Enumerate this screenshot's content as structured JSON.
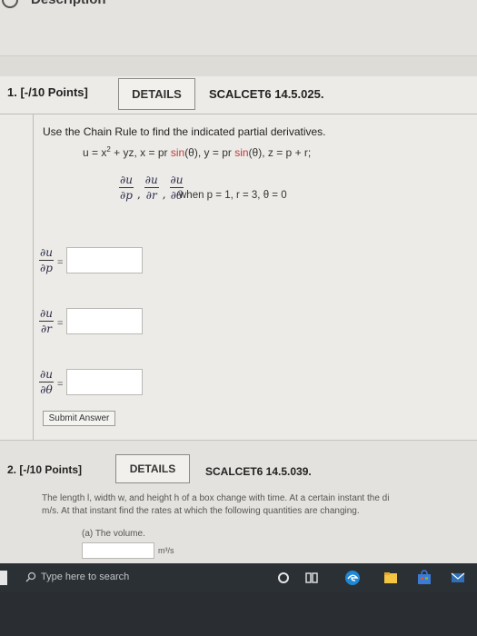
{
  "header": {
    "title": "Description"
  },
  "question1": {
    "number_label": "1. [-/10 Points]",
    "details_label": "DETAILS",
    "code": "SCALCET6 14.5.025.",
    "instruction": "Use the Chain Rule to find the indicated partial derivatives.",
    "equation": {
      "u_part": "u = x",
      "exp": "2",
      "rest_a": " + yz, x = pr ",
      "sin1": "sin",
      "rest_b": "(θ), y = pr ",
      "sin2": "sin",
      "rest_c": "(θ), z = p + r;"
    },
    "derivatives": [
      {
        "num": "∂u",
        "den": "∂p"
      },
      {
        "num": "∂u",
        "den": "∂r"
      },
      {
        "num": "∂u",
        "den": "∂θ"
      }
    ],
    "when_text": "when p = 1, r = 3, θ = 0",
    "answers": [
      {
        "num": "∂u",
        "den": "∂p",
        "eq": "=",
        "value": ""
      },
      {
        "num": "∂u",
        "den": "∂r",
        "eq": "=",
        "value": ""
      },
      {
        "num": "∂u",
        "den": "∂θ",
        "eq": "=",
        "value": ""
      }
    ],
    "submit_label": "Submit Answer"
  },
  "question2": {
    "number_label": "2. [-/10 Points]",
    "details_label": "DETAILS",
    "code": "SCALCET6 14.5.039.",
    "text_line1": "The length l, width w, and height h of a box change with time. At a certain instant the di",
    "text_line2": "m/s. At that instant find the rates at which the following quantities are changing.",
    "sub_label": "(a) The volume.",
    "unit": "m³/s"
  },
  "taskbar": {
    "search_placeholder": "Type here to search"
  },
  "colors": {
    "accent_red": "#c23a3a",
    "edge_blue": "#1e88d6",
    "taskbar": "#2b3034"
  }
}
